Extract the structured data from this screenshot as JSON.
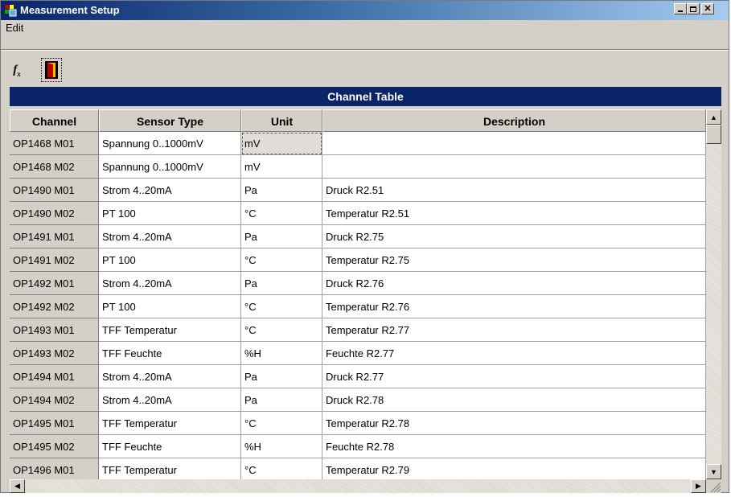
{
  "window": {
    "title": "Measurement Setup"
  },
  "menu": {
    "items": [
      {
        "label": "Edit"
      }
    ]
  },
  "toolbar": {
    "fx_label": "fx"
  },
  "table": {
    "title": "Channel Table",
    "columns": [
      "Channel",
      "Sensor Type",
      "Unit",
      "Description"
    ],
    "rows": [
      [
        "OP1468 M01",
        "Spannung 0..1000mV",
        "mV",
        ""
      ],
      [
        "OP1468 M02",
        "Spannung 0..1000mV",
        "mV",
        ""
      ],
      [
        "OP1490 M01",
        "Strom 4..20mA",
        "Pa",
        "Druck R2.51"
      ],
      [
        "OP1490 M02",
        "PT 100",
        "°C",
        "Temperatur R2.51"
      ],
      [
        "OP1491 M01",
        "Strom 4..20mA",
        "Pa",
        "Druck R2.75"
      ],
      [
        "OP1491 M02",
        "PT 100",
        "°C",
        "Temperatur R2.75"
      ],
      [
        "OP1492 M01",
        "Strom 4..20mA",
        "Pa",
        "Druck R2.76"
      ],
      [
        "OP1492 M02",
        "PT 100",
        "°C",
        "Temperatur R2.76"
      ],
      [
        "OP1493 M01",
        "TFF Temperatur",
        "°C",
        "Temperatur R2.77"
      ],
      [
        "OP1493 M02",
        "TFF Feuchte",
        "%H",
        "Feuchte R2.77"
      ],
      [
        "OP1494 M01",
        "Strom 4..20mA",
        "Pa",
        "Druck R2.77"
      ],
      [
        "OP1494 M02",
        "Strom 4..20mA",
        "Pa",
        "Druck R2.78"
      ],
      [
        "OP1495 M01",
        "TFF Temperatur",
        "°C",
        "Temperatur R2.78"
      ],
      [
        "OP1495 M02",
        "TFF Feuchte",
        "%H",
        "Feuchte R2.78"
      ],
      [
        "OP1496 M01",
        "TFF Temperatur",
        "°C",
        "Temperatur R2.79"
      ]
    ]
  },
  "colors": {
    "title_start": "#0a246a",
    "title_end": "#a6caf0",
    "header_bar": "#0a246a",
    "face": "#d4d0c8"
  }
}
